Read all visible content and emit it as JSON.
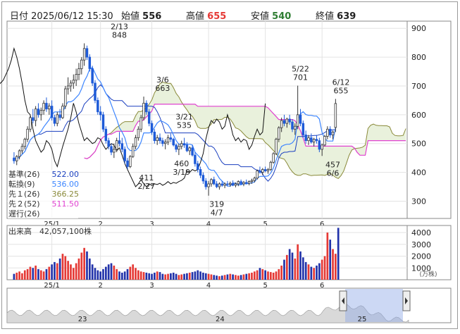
{
  "header": {
    "date_label": "日付",
    "date_value": "2025/06/12 15:30",
    "open_label": "始値",
    "open_value": "556",
    "high_label": "高値",
    "high_value": "655",
    "low_label": "安値",
    "low_value": "540",
    "close_label": "終値",
    "close_value": "639"
  },
  "colors": {
    "up": "#e53935",
    "down": "#1e5bd8",
    "high_value": "#e53935",
    "low_value": "#2e7d32",
    "base_line": "#1a3fbf",
    "conv_line": "#3d86ff",
    "span1": "#8a8a3a",
    "span2": "#e040d0",
    "lagging": "#111111",
    "cloud": "#e9f1dc",
    "volume_down": "#2233aa",
    "volume_up": "#e53935",
    "overview_fill": "#d9d9d9",
    "overview_fill_selected": "#8fa8e6"
  },
  "legend": [
    {
      "label": "基準(26)",
      "value": "522.00",
      "color": "#1a3fbf"
    },
    {
      "label": "転換(9)",
      "value": "536.00",
      "color": "#3d86ff"
    },
    {
      "label": "先１(26)",
      "value": "366.25",
      "color": "#8a8a3a"
    },
    {
      "label": "先２(52)",
      "value": "511.50",
      "color": "#e040d0"
    },
    {
      "label": "遅行(26)",
      "value": "",
      "color": "#111111"
    }
  ],
  "volume_label": "出来高",
  "volume_value": "42,057,100株",
  "volume_unit": "(万株)",
  "chart_data": {
    "type": "candlestick",
    "price_axis": {
      "ticks": [
        300,
        400,
        500,
        600,
        700,
        800,
        900
      ],
      "range": [
        240,
        925
      ]
    },
    "volume_axis": {
      "ticks": [
        1000,
        2000,
        3000,
        4000
      ],
      "range": [
        0,
        4600
      ]
    },
    "x_month_labels": [
      {
        "label": "25/1",
        "index": 14
      },
      {
        "label": "2",
        "index": 32
      },
      {
        "label": "3",
        "index": 51
      },
      {
        "label": "4",
        "index": 72
      },
      {
        "label": "5",
        "index": 93
      },
      {
        "label": "6",
        "index": 114
      }
    ],
    "annotations": [
      {
        "date": "2/13",
        "value": "848",
        "index": 39,
        "price": 848,
        "pos": "above"
      },
      {
        "date": "3/6",
        "value": "663",
        "index": 55,
        "price": 663,
        "pos": "above"
      },
      {
        "date": "3/21",
        "value": "535",
        "index": 63,
        "price": 535,
        "pos": "above"
      },
      {
        "date": "5/22",
        "value": "701",
        "index": 106,
        "price": 701,
        "pos": "above"
      },
      {
        "date": "6/12",
        "value": "655",
        "index": 121,
        "price": 655,
        "pos": "above"
      },
      {
        "value": "411",
        "date": "2/27",
        "index": 49,
        "price": 411,
        "pos": "below"
      },
      {
        "value": "460",
        "date": "3/19",
        "index": 62,
        "price": 460,
        "pos": "below"
      },
      {
        "value": "319",
        "date": "4/7",
        "index": 75,
        "price": 319,
        "pos": "below"
      },
      {
        "value": "457",
        "date": "6/6",
        "index": 118,
        "price": 457,
        "pos": "below"
      }
    ],
    "candles": [
      [
        450,
        470,
        430,
        440
      ],
      [
        440,
        460,
        425,
        455
      ],
      [
        455,
        480,
        445,
        475
      ],
      [
        475,
        500,
        465,
        490
      ],
      [
        490,
        520,
        480,
        515
      ],
      [
        515,
        560,
        505,
        550
      ],
      [
        550,
        600,
        540,
        590
      ],
      [
        590,
        620,
        570,
        580
      ],
      [
        580,
        630,
        560,
        620
      ],
      [
        620,
        640,
        590,
        600
      ],
      [
        600,
        625,
        580,
        615
      ],
      [
        615,
        650,
        600,
        640
      ],
      [
        640,
        660,
        610,
        620
      ],
      [
        620,
        640,
        600,
        630
      ],
      [
        630,
        650,
        580,
        590
      ],
      [
        590,
        600,
        560,
        570
      ],
      [
        570,
        610,
        560,
        600
      ],
      [
        600,
        620,
        580,
        590
      ],
      [
        590,
        640,
        585,
        630
      ],
      [
        630,
        700,
        620,
        690
      ],
      [
        690,
        730,
        670,
        700
      ],
      [
        700,
        720,
        680,
        710
      ],
      [
        710,
        740,
        690,
        720
      ],
      [
        720,
        760,
        700,
        740
      ],
      [
        740,
        780,
        720,
        760
      ],
      [
        760,
        800,
        740,
        790
      ],
      [
        790,
        848,
        770,
        830
      ],
      [
        830,
        840,
        790,
        800
      ],
      [
        800,
        810,
        750,
        760
      ],
      [
        760,
        770,
        700,
        710
      ],
      [
        710,
        720,
        640,
        650
      ],
      [
        650,
        660,
        600,
        610
      ],
      [
        610,
        630,
        580,
        600
      ],
      [
        600,
        610,
        540,
        550
      ],
      [
        550,
        560,
        500,
        510
      ],
      [
        510,
        520,
        480,
        490
      ],
      [
        490,
        500,
        460,
        470
      ],
      [
        470,
        500,
        450,
        480
      ],
      [
        480,
        520,
        470,
        510
      ],
      [
        510,
        540,
        490,
        500
      ],
      [
        500,
        520,
        470,
        480
      ],
      [
        480,
        490,
        430,
        440
      ],
      [
        440,
        450,
        411,
        420
      ],
      [
        420,
        460,
        415,
        455
      ],
      [
        455,
        500,
        450,
        490
      ],
      [
        490,
        530,
        480,
        520
      ],
      [
        520,
        560,
        510,
        550
      ],
      [
        550,
        600,
        540,
        590
      ],
      [
        590,
        663,
        580,
        640
      ],
      [
        640,
        650,
        600,
        610
      ],
      [
        610,
        620,
        560,
        570
      ],
      [
        570,
        580,
        530,
        540
      ],
      [
        540,
        550,
        500,
        510
      ],
      [
        510,
        530,
        495,
        520
      ],
      [
        520,
        535,
        500,
        510
      ],
      [
        510,
        520,
        490,
        500
      ],
      [
        500,
        515,
        480,
        505
      ],
      [
        505,
        530,
        495,
        520
      ],
      [
        520,
        535,
        505,
        515
      ],
      [
        515,
        520,
        490,
        495
      ],
      [
        495,
        500,
        470,
        480
      ],
      [
        480,
        500,
        460,
        490
      ],
      [
        490,
        510,
        480,
        500
      ],
      [
        500,
        520,
        485,
        495
      ],
      [
        495,
        505,
        470,
        475
      ],
      [
        475,
        490,
        460,
        485
      ],
      [
        485,
        495,
        455,
        460
      ],
      [
        460,
        470,
        420,
        430
      ],
      [
        430,
        440,
        400,
        410
      ],
      [
        410,
        420,
        380,
        390
      ],
      [
        390,
        400,
        360,
        370
      ],
      [
        370,
        380,
        340,
        350
      ],
      [
        350,
        370,
        319,
        360
      ],
      [
        360,
        380,
        350,
        375
      ],
      [
        375,
        385,
        355,
        360
      ],
      [
        360,
        370,
        345,
        350
      ],
      [
        350,
        365,
        340,
        360
      ],
      [
        360,
        370,
        350,
        355
      ],
      [
        355,
        365,
        345,
        360
      ],
      [
        360,
        370,
        352,
        358
      ],
      [
        358,
        368,
        350,
        362
      ],
      [
        362,
        372,
        352,
        355
      ],
      [
        355,
        365,
        348,
        360
      ],
      [
        360,
        372,
        352,
        368
      ],
      [
        368,
        375,
        355,
        360
      ],
      [
        360,
        370,
        352,
        365
      ],
      [
        365,
        375,
        358,
        362
      ],
      [
        362,
        372,
        355,
        368
      ],
      [
        368,
        378,
        360,
        372
      ],
      [
        372,
        385,
        365,
        380
      ],
      [
        380,
        410,
        375,
        405
      ],
      [
        405,
        420,
        395,
        400
      ],
      [
        400,
        415,
        390,
        410
      ],
      [
        410,
        420,
        400,
        405
      ],
      [
        405,
        415,
        395,
        410
      ],
      [
        410,
        440,
        405,
        435
      ],
      [
        435,
        470,
        430,
        465
      ],
      [
        465,
        520,
        460,
        515
      ],
      [
        515,
        560,
        505,
        555
      ],
      [
        555,
        590,
        540,
        580
      ],
      [
        580,
        600,
        560,
        570
      ],
      [
        570,
        590,
        555,
        585
      ],
      [
        585,
        600,
        565,
        575
      ],
      [
        575,
        585,
        540,
        550
      ],
      [
        550,
        570,
        530,
        560
      ],
      [
        560,
        701,
        550,
        600
      ],
      [
        600,
        620,
        560,
        570
      ],
      [
        570,
        580,
        520,
        530
      ],
      [
        530,
        545,
        500,
        510
      ],
      [
        510,
        530,
        495,
        520
      ],
      [
        520,
        535,
        500,
        505
      ],
      [
        505,
        520,
        490,
        515
      ],
      [
        515,
        530,
        500,
        510
      ],
      [
        510,
        520,
        470,
        480
      ],
      [
        480,
        500,
        457,
        495
      ],
      [
        495,
        530,
        490,
        525
      ],
      [
        525,
        560,
        515,
        550
      ],
      [
        550,
        560,
        520,
        530
      ],
      [
        530,
        545,
        515,
        540
      ],
      [
        556,
        655,
        540,
        639
      ]
    ],
    "volume": [
      500,
      600,
      700,
      550,
      800,
      900,
      1100,
      1000,
      1200,
      900,
      800,
      700,
      900,
      1100,
      1300,
      1500,
      1400,
      1800,
      2200,
      2000,
      1600,
      1300,
      1000,
      1400,
      1800,
      2300,
      2700,
      2400,
      1800,
      1300,
      1000,
      800,
      700,
      900,
      1100,
      1300,
      1400,
      1200,
      900,
      700,
      600,
      700,
      900,
      1100,
      1300,
      1000,
      800,
      700,
      650,
      600,
      550,
      500,
      600,
      700,
      650,
      500,
      450,
      500,
      550,
      600,
      500,
      400,
      450,
      500,
      550,
      600,
      650,
      700,
      800,
      700,
      600,
      550,
      500,
      450,
      400,
      350,
      300,
      350,
      400,
      450,
      500,
      450,
      400,
      350,
      400,
      450,
      500,
      550,
      600,
      700,
      800,
      1000,
      900,
      800,
      700,
      650,
      600,
      700,
      900,
      1200,
      1700,
      2100,
      2600,
      2300,
      1800,
      3000,
      2400,
      1900,
      1500,
      1300,
      1100,
      1000,
      1200,
      1400,
      1700,
      2000,
      4000,
      3400,
      2600,
      2200,
      4400
    ],
    "volume_up_flags_note": "",
    "overview": {
      "labels": [
        {
          "label": "23",
          "pos": 0.17
        },
        {
          "label": "24",
          "pos": 0.48
        },
        {
          "label": "25",
          "pos": 0.8
        }
      ]
    }
  }
}
